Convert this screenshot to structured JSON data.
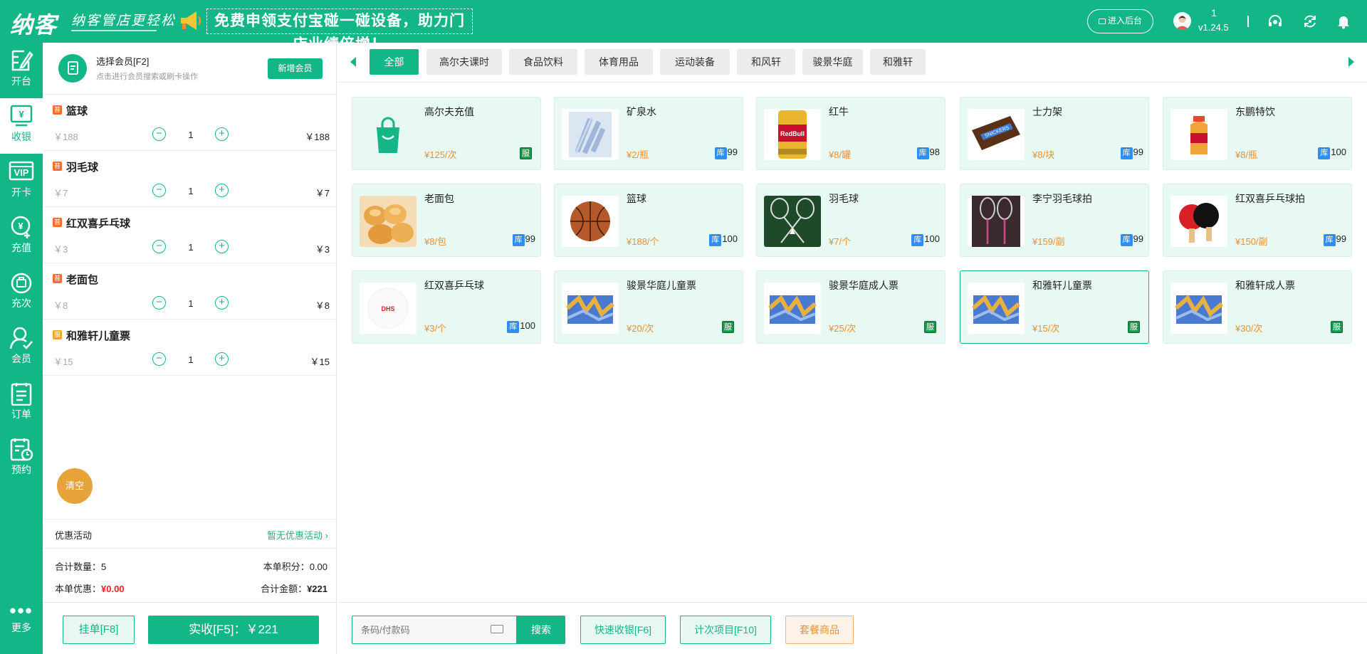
{
  "header": {
    "logo": "纳客",
    "slogan": "纳客管店更轻松",
    "promo": "免费申领支付宝碰一碰设备，助力门店业绩倍增！",
    "backend_btn": "进入后台",
    "user_id": "1",
    "version": "v1.24.5"
  },
  "sidebar": {
    "items": [
      {
        "label": "开台",
        "icon": "open-table-icon"
      },
      {
        "label": "收银",
        "icon": "cashier-icon"
      },
      {
        "label": "开卡",
        "icon": "vip-card-icon"
      },
      {
        "label": "充值",
        "icon": "recharge-icon"
      },
      {
        "label": "充次",
        "icon": "recharge-times-icon"
      },
      {
        "label": "会员",
        "icon": "member-icon"
      },
      {
        "label": "订单",
        "icon": "order-icon"
      },
      {
        "label": "预约",
        "icon": "appointment-icon"
      }
    ],
    "more": "更多"
  },
  "member": {
    "title": "选择会员[F2]",
    "subtitle": "点击进行会员搜索或刷卡操作",
    "new_btn": "新增会员"
  },
  "cart": {
    "items": [
      {
        "tag": "普",
        "name": "篮球",
        "price": "￥188",
        "qty": "1",
        "subtotal": "￥188"
      },
      {
        "tag": "普",
        "name": "羽毛球",
        "price": "￥7",
        "qty": "1",
        "subtotal": "￥7"
      },
      {
        "tag": "普",
        "name": "红双喜乒乓球",
        "price": "￥3",
        "qty": "1",
        "subtotal": "￥3"
      },
      {
        "tag": "普",
        "name": "老面包",
        "price": "￥8",
        "qty": "1",
        "subtotal": "￥8"
      },
      {
        "tag": "服",
        "name": "和雅轩儿童票",
        "price": "￥15",
        "qty": "1",
        "subtotal": "￥15"
      }
    ],
    "clear_btn": "清空",
    "promo_label": "优惠活动",
    "promo_value": "暂无优惠活动",
    "total_qty_label": "合计数量：",
    "total_qty": "5",
    "points_label": "本单积分：",
    "points": "0.00",
    "discount_label": "本单优惠：",
    "discount": "¥0.00",
    "total_label": "合计金额：",
    "total": "¥221",
    "hang_btn": "挂单[F8]",
    "pay_btn": "实收[F5]：￥221"
  },
  "tabs": [
    "全部",
    "高尔夫课时",
    "食品饮料",
    "体育用品",
    "运动装备",
    "和风轩",
    "骏景华庭",
    "和雅轩"
  ],
  "products": [
    {
      "name": "高尔夫充值",
      "price": "¥125/次",
      "type": "service",
      "badge": "服",
      "image": "shopping-bag-icon"
    },
    {
      "name": "矿泉水",
      "price": "¥2/瓶",
      "type": "stock",
      "badge": "库",
      "stock": "99",
      "image": "water-bottles-image"
    },
    {
      "name": "红牛",
      "price": "¥8/罐",
      "type": "stock",
      "badge": "库",
      "stock": "98",
      "image": "red-bull-can-image"
    },
    {
      "name": "士力架",
      "price": "¥8/块",
      "type": "stock",
      "badge": "库",
      "stock": "99",
      "image": "snickers-image"
    },
    {
      "name": "东鹏特饮",
      "price": "¥8/瓶",
      "type": "stock",
      "badge": "库",
      "stock": "100",
      "image": "energy-drink-bottle-image"
    },
    {
      "name": "老面包",
      "price": "¥8/包",
      "type": "stock",
      "badge": "库",
      "stock": "99",
      "image": "bread-image"
    },
    {
      "name": "篮球",
      "price": "¥188/个",
      "type": "stock",
      "badge": "库",
      "stock": "100",
      "image": "basketball-image"
    },
    {
      "name": "羽毛球",
      "price": "¥7/个",
      "type": "stock",
      "badge": "库",
      "stock": "100",
      "image": "badminton-image"
    },
    {
      "name": "李宁羽毛球拍",
      "price": "¥159/副",
      "type": "stock",
      "badge": "库",
      "stock": "99",
      "image": "badminton-racket-image"
    },
    {
      "name": "红双喜乒乓球拍",
      "price": "¥150/副",
      "type": "stock",
      "badge": "库",
      "stock": "99",
      "image": "pingpong-paddle-image"
    },
    {
      "name": "红双喜乒乓球",
      "price": "¥3/个",
      "type": "stock",
      "badge": "库",
      "stock": "100",
      "image": "pingpong-ball-image"
    },
    {
      "name": "骏景华庭儿童票",
      "price": "¥20/次",
      "type": "service",
      "badge": "服",
      "image": "ticket-image"
    },
    {
      "name": "骏景华庭成人票",
      "price": "¥25/次",
      "type": "service",
      "badge": "服",
      "image": "ticket-image"
    },
    {
      "name": "和雅轩儿童票",
      "price": "¥15/次",
      "type": "service",
      "badge": "服",
      "image": "ticket-image",
      "selected": true
    },
    {
      "name": "和雅轩成人票",
      "price": "¥30/次",
      "type": "service",
      "badge": "服",
      "image": "ticket-image"
    }
  ],
  "bottom": {
    "search_placeholder": "条码/付款码",
    "search_btn": "搜索",
    "quick_btn": "快速收银[F6]",
    "times_btn": "计次项目[F10]",
    "package_btn": "套餐商品"
  },
  "colors": {
    "primary": "#13b687",
    "accent_orange": "#f0902a",
    "discount_red": "#ee1c25",
    "stock_blue": "#2f8ef2",
    "service_green": "#149a4a"
  }
}
